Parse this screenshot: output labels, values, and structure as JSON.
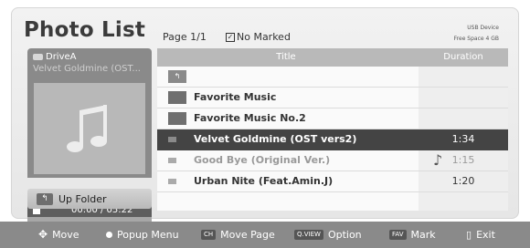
{
  "header": {
    "title": "Photo List",
    "page": "Page 1/1",
    "marked": "No Marked",
    "device": "USB Device",
    "free_space": "Free Space 4 GB"
  },
  "preview": {
    "drive": "DriveA",
    "file": "Velvet Goldmine (OST...",
    "time": "00:00 / 05:22"
  },
  "up_folder_label": "Up Folder",
  "list": {
    "col_title": "Title",
    "col_duration": "Duration",
    "rows": [
      {
        "name": "",
        "duration": ""
      },
      {
        "name": "Favorite Music",
        "duration": ""
      },
      {
        "name": "Favorite Music No.2",
        "duration": ""
      },
      {
        "name": "Velvet Goldmine (OST vers2)",
        "duration": "1:34"
      },
      {
        "name": "Good Bye (Original Ver.)",
        "duration": "1:15"
      },
      {
        "name": "Urban Nite (Feat.Amin.J)",
        "duration": "1:20"
      }
    ]
  },
  "help": {
    "move": "Move",
    "popup": "Popup Menu",
    "ch_key": "CH",
    "move_page": "Move Page",
    "qview_key": "Q.VIEW",
    "option": "Option",
    "fav_key": "FAV",
    "mark": "Mark",
    "exit": "Exit"
  },
  "icons": [
    "drive-icon",
    "music-note-icon",
    "stop-icon",
    "up-folder-icon",
    "folder-icon",
    "song-icon",
    "dpad-icon",
    "ok-icon",
    "exit-icon"
  ]
}
